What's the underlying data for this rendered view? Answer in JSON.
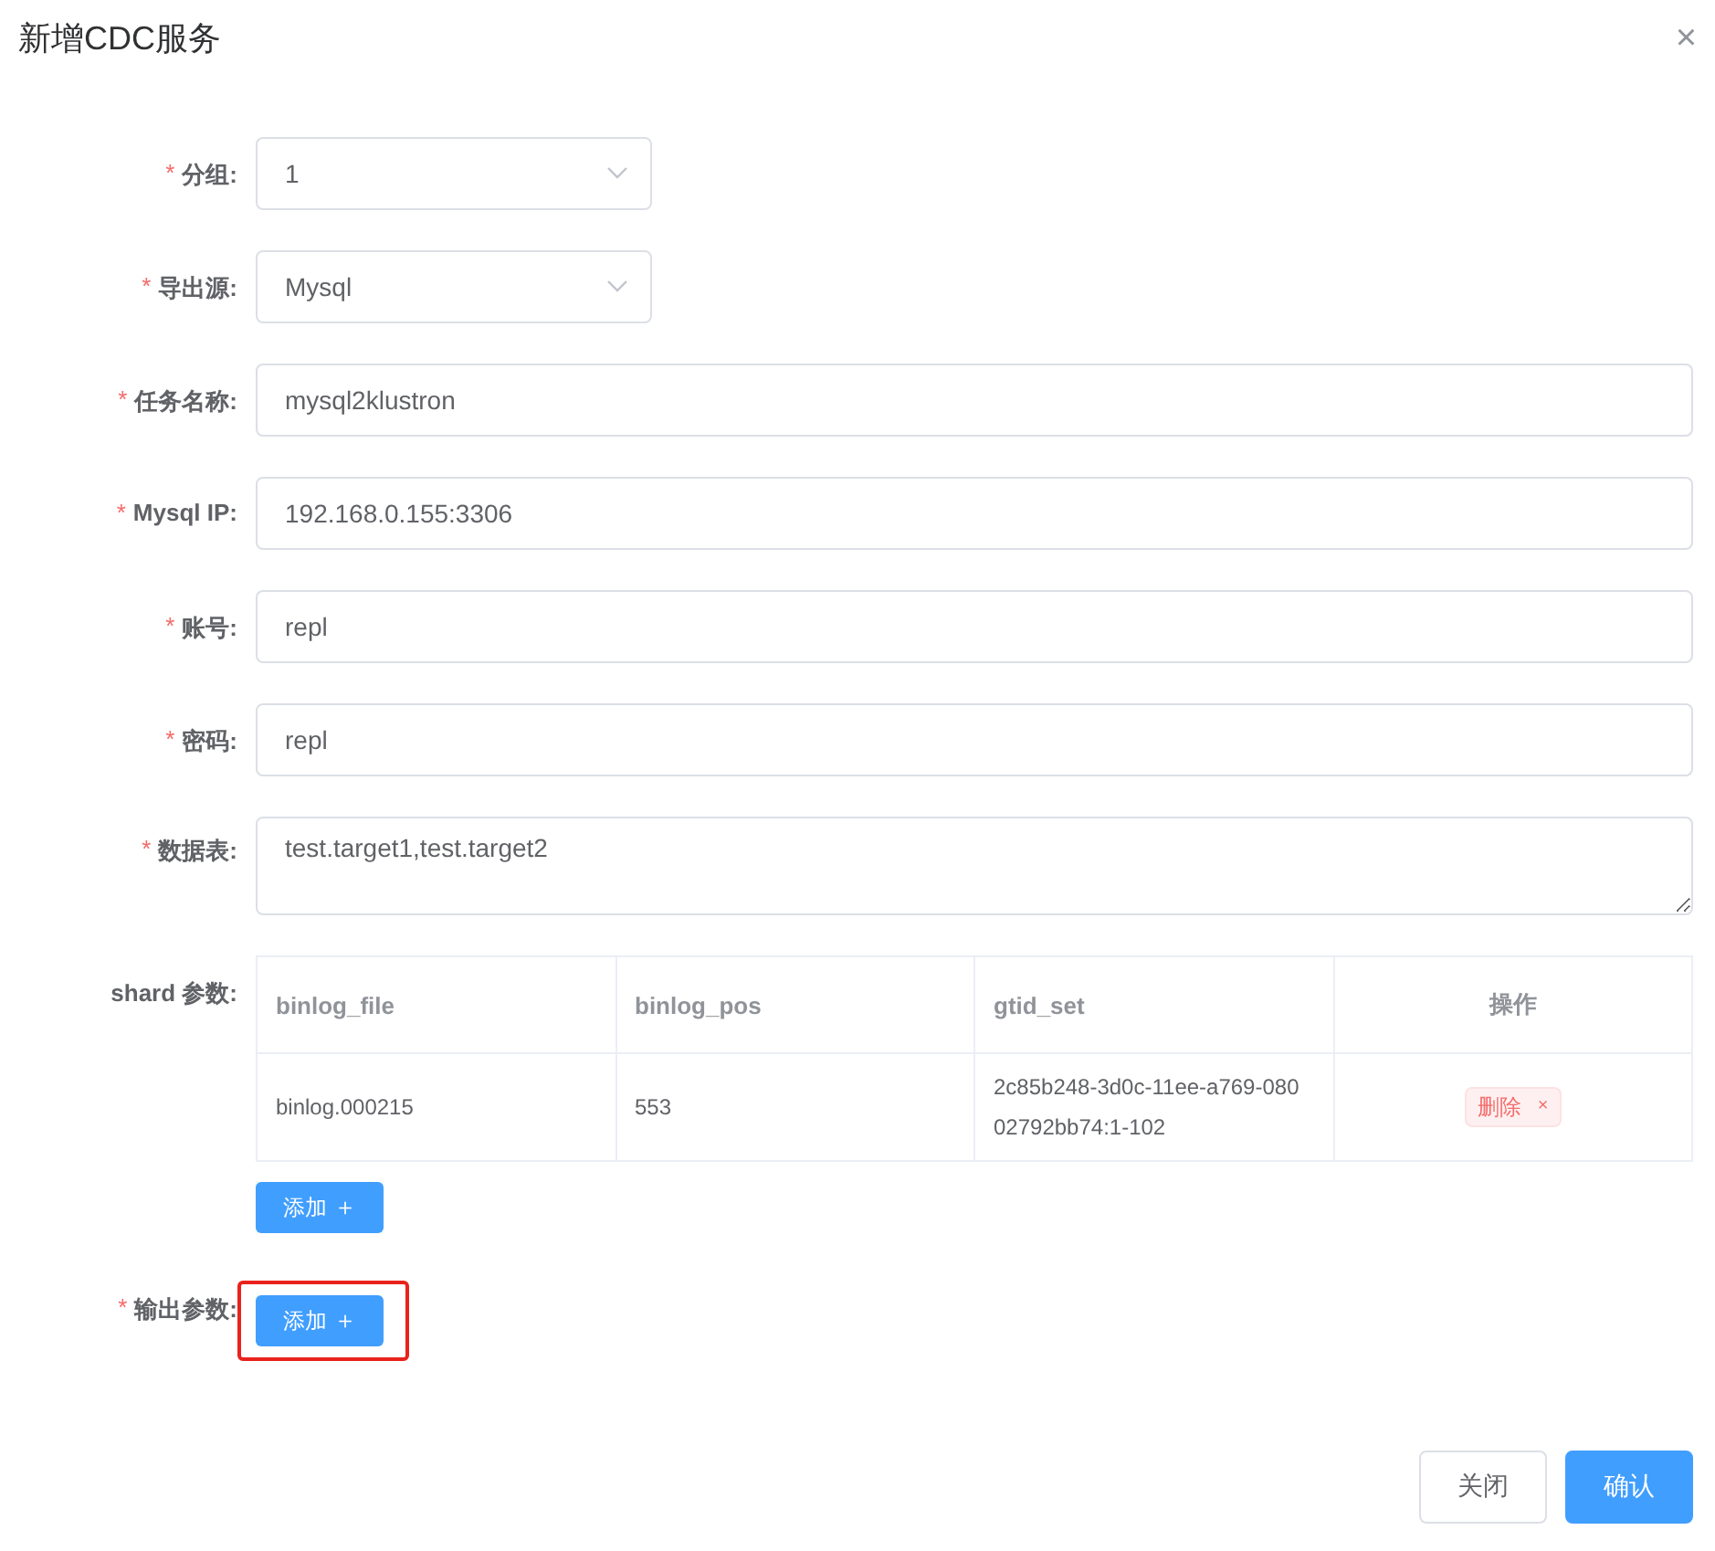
{
  "dialog": {
    "title": "新增CDC服务",
    "close": "×"
  },
  "fields": [
    {
      "kind": "select",
      "label": "分组:",
      "required_mark": "*",
      "value": "1"
    },
    {
      "kind": "select",
      "label": "导出源:",
      "required_mark": "*",
      "value": "Mysql"
    },
    {
      "kind": "input",
      "label": "任务名称:",
      "required_mark": "*",
      "value": "mysql2klustron"
    },
    {
      "kind": "input",
      "label": "Mysql IP:",
      "required_mark": "*",
      "value": "192.168.0.155:3306"
    },
    {
      "kind": "input",
      "label": "账号:",
      "required_mark": "*",
      "value": "repl"
    },
    {
      "kind": "input",
      "label": "密码:",
      "required_mark": "*",
      "value": "repl"
    },
    {
      "kind": "textarea",
      "label": "数据表:",
      "required_mark": "*",
      "value": "test.target1,test.target2"
    },
    {
      "kind": "table",
      "label": "shard 参数:",
      "highlighted": false,
      "columns": [
        "binlog_file",
        "binlog_pos",
        "gtid_set",
        "操作"
      ],
      "rows": [
        {
          "cells": [
            "binlog.000215",
            "553",
            "2c85b248-3d0c-11ee-a769-080 02792bb74:1-102"
          ],
          "action": "删除",
          "action_close": "×"
        }
      ],
      "add": "添加",
      "add_icon": "＋"
    },
    {
      "kind": "add",
      "label": "输出参数:",
      "required_mark": "*",
      "highlighted": true,
      "add": "添加",
      "add_icon": "＋"
    }
  ],
  "footer": {
    "buttons": [
      {
        "label": "关闭",
        "primary": false
      },
      {
        "label": "确认",
        "primary": true
      }
    ]
  }
}
